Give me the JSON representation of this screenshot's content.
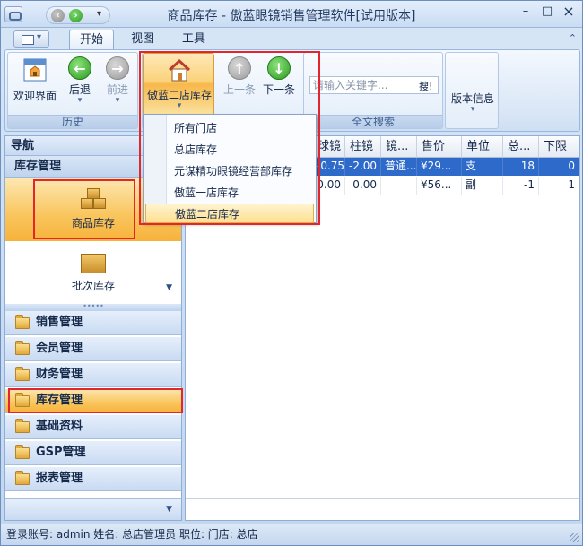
{
  "window": {
    "title": "商品库存 - 傲蓝眼镜销售管理软件[试用版本]",
    "min": "–",
    "max": "□",
    "close": "×"
  },
  "qat": {
    "dropdown": "▾"
  },
  "tabs": [
    {
      "label": "开始"
    },
    {
      "label": "视图"
    },
    {
      "label": "工具"
    }
  ],
  "ribbon": {
    "collapse": "⌃",
    "history_group": "历史",
    "welcome": "欢迎界面",
    "back": "后退",
    "forward": "前进",
    "store": "傲蓝二店库存",
    "prev": "上一条",
    "next": "下一条",
    "search_group": "全文搜索",
    "search_placeholder": "请输入关键字...",
    "search_button": "搜!",
    "version": "版本信息"
  },
  "store_menu": [
    "所有门店",
    "总店库存",
    "元谋精功眼镜经营部库存",
    "傲蓝一店库存",
    "傲蓝二店库存"
  ],
  "nav": {
    "header": "导航",
    "section": "库存管理",
    "items": [
      {
        "label": "商品库存"
      },
      {
        "label": "批次库存"
      }
    ],
    "splitter": "•••••",
    "categories": [
      "销售管理",
      "会员管理",
      "财务管理",
      "库存管理",
      "基础资料",
      "GSP管理",
      "报表管理"
    ]
  },
  "grid": {
    "columns": [
      "球镜",
      "柱镜",
      "镜...",
      "售价",
      "单位",
      "总...",
      "下限"
    ],
    "rows": [
      [
        "-0.75",
        "-2.00",
        "普通...",
        "¥29...",
        "支",
        "18",
        "0"
      ],
      [
        "0.00",
        "0.00",
        "",
        "¥56...",
        "副",
        "-1",
        "1"
      ]
    ]
  },
  "status": {
    "text": "登录账号: admin  姓名: 总店管理员  职位:   门店: 总店"
  }
}
